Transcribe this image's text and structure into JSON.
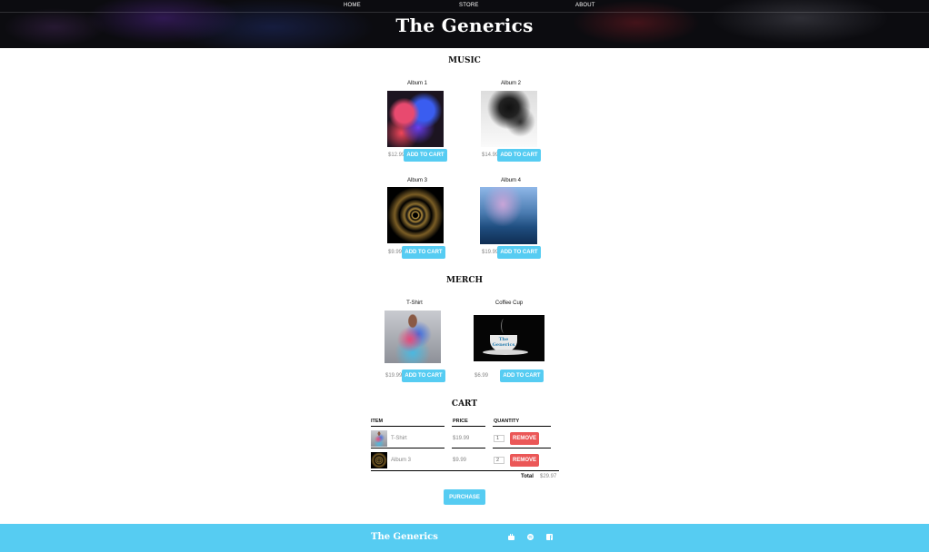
{
  "nav": {
    "home": "HOME",
    "store": "STORE",
    "about": "ABOUT"
  },
  "header": {
    "title": "The Generics"
  },
  "music": {
    "title": "MUSIC",
    "items": [
      {
        "title": "Album 1",
        "price": "$12.99",
        "button": "ADD TO CART"
      },
      {
        "title": "Album 2",
        "price": "$14.99",
        "button": "ADD TO CART"
      },
      {
        "title": "Album 3",
        "price": "$9.99",
        "button": "ADD TO CART"
      },
      {
        "title": "Album 4",
        "price": "$19.99",
        "button": "ADD TO CART"
      }
    ]
  },
  "merch": {
    "title": "MERCH",
    "items": [
      {
        "title": "T-Shirt",
        "price": "$19.99",
        "button": "ADD TO CART",
        "cup_label": ""
      },
      {
        "title": "Coffee Cup",
        "price": "$6.99",
        "button": "ADD TO CART",
        "cup_label": "The Generics"
      }
    ]
  },
  "cart": {
    "title": "CART",
    "headers": {
      "item": "ITEM",
      "price": "PRICE",
      "quantity": "QUANTITY"
    },
    "rows": [
      {
        "name": "T-Shirt",
        "price": "$19.99",
        "qty": "1",
        "remove": "REMOVE"
      },
      {
        "name": "Album 3",
        "price": "$9.99",
        "qty": "2",
        "remove": "REMOVE"
      }
    ],
    "total_label": "Total",
    "total_value": "$29.97",
    "purchase": "PURCHASE"
  },
  "footer": {
    "brand": "The Generics",
    "icons": [
      "youtube-icon",
      "spotify-icon",
      "facebook-icon"
    ]
  },
  "colors": {
    "accent": "#56ccf2",
    "danger": "#eb5757"
  }
}
